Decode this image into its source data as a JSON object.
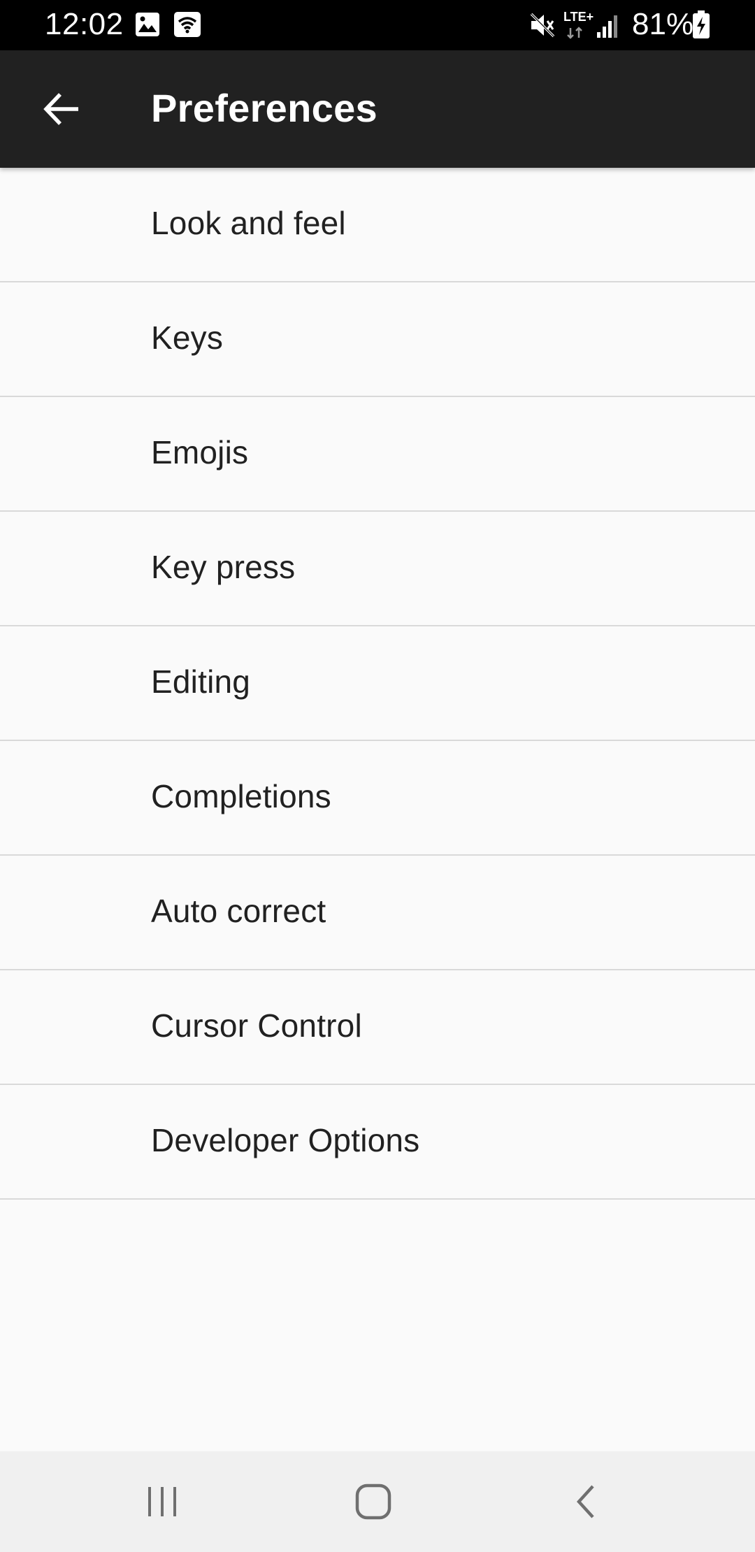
{
  "status_bar": {
    "time": "12:02",
    "network_label": "LTE+",
    "battery_percent": "81%",
    "icons": [
      "image-icon",
      "wifi-icon",
      "mute-icon",
      "signal-icon",
      "battery-charging-icon"
    ]
  },
  "app_bar": {
    "title": "Preferences",
    "back_icon": "arrow-left-icon",
    "background": "#212121"
  },
  "preferences": {
    "items": [
      {
        "label": "Look and feel"
      },
      {
        "label": "Keys"
      },
      {
        "label": "Emojis"
      },
      {
        "label": "Key press"
      },
      {
        "label": "Editing"
      },
      {
        "label": "Completions"
      },
      {
        "label": "Auto correct"
      },
      {
        "label": "Cursor Control"
      },
      {
        "label": "Developer Options"
      }
    ]
  },
  "nav_bar": {
    "buttons": [
      "recent-apps-icon",
      "home-icon",
      "back-icon"
    ]
  }
}
